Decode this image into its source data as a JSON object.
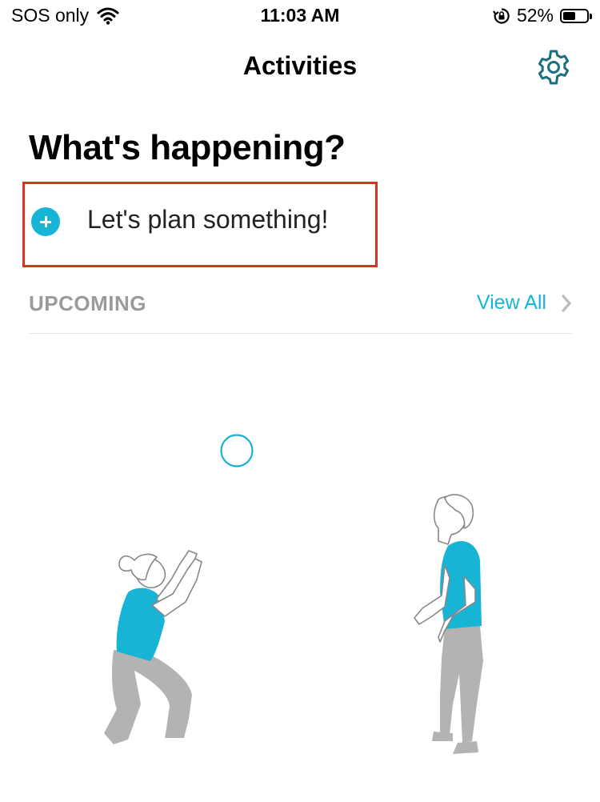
{
  "status_bar": {
    "carrier": "SOS only",
    "time": "11:03 AM",
    "battery_percent": "52%",
    "battery_level": 0.52,
    "icons": [
      "wifi-icon",
      "orientation-lock-icon",
      "battery-icon"
    ]
  },
  "nav": {
    "title": "Activities",
    "settings_icon": "gear-icon"
  },
  "main": {
    "heading": "What's happening?",
    "plan_label": "Let's plan something!",
    "plan_icon": "plus-circle-icon",
    "upcoming": {
      "title": "UPCOMING",
      "view_all_label": "View All",
      "view_all_icon": "chevron-right-icon"
    },
    "illustration": "two-people-playing-ball-illustration"
  },
  "colors": {
    "accent": "#17b4d6",
    "highlight_border": "#d6361f",
    "section_gray": "#9a9a9a",
    "figure_gray": "#b3b3b3",
    "gear_teal": "#1a6f80"
  }
}
